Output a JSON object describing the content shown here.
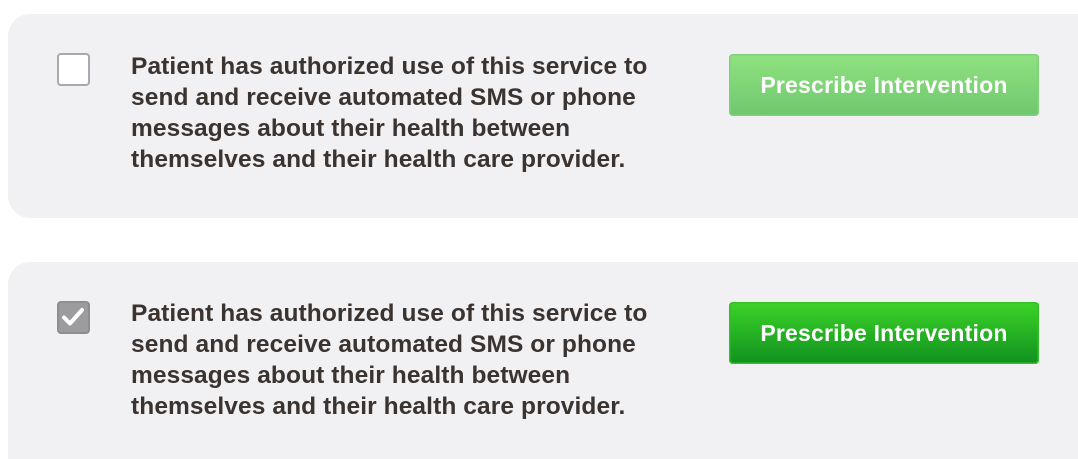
{
  "consent_rows": [
    {
      "state": "unchecked",
      "consent_text": "Patient has authorized use of this service to send and receive automated SMS or phone messages about their health between themselves and their health care provider.",
      "button_label": "Prescribe Intervention",
      "button_state": "disabled",
      "button_color": "#7fd27a"
    },
    {
      "state": "checked",
      "consent_text": "Patient has authorized use of this service to send and receive automated SMS or phone messages about their health between themselves and their health care provider.",
      "button_label": "Prescribe Intervention",
      "button_state": "enabled",
      "button_color": "#23b522",
      "checkbox_icon": "checkmark-icon"
    }
  ]
}
